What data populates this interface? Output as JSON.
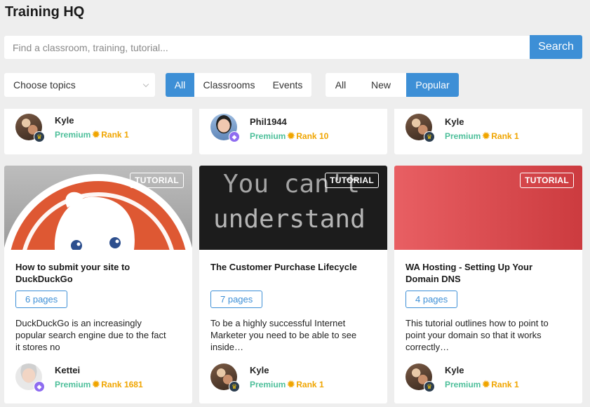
{
  "app": {
    "title": "Training HQ"
  },
  "search": {
    "placeholder": "Find a classroom, training, tutorial...",
    "button_label": "Search"
  },
  "filters": {
    "topics_label": "Choose topics",
    "type_options": [
      {
        "label": "All",
        "active": true
      },
      {
        "label": "Classrooms",
        "active": false
      },
      {
        "label": "Events",
        "active": false
      }
    ],
    "sort_options": [
      {
        "label": "All",
        "active": false
      },
      {
        "label": "New",
        "active": false
      },
      {
        "label": "Popular",
        "active": true
      }
    ]
  },
  "top_cards": [
    {
      "author": "Kyle",
      "membership": "Premium",
      "rank": "Rank 1",
      "badge": "crown-icon"
    },
    {
      "author": "Phil1944",
      "membership": "Premium",
      "rank": "Rank 10",
      "badge": "gem-icon"
    },
    {
      "author": "Kyle",
      "membership": "Premium",
      "rank": "Rank 1",
      "badge": "crown-icon"
    }
  ],
  "cards": [
    {
      "tag": "TUTORIAL",
      "title": "How to submit your site to DuckDuckGo",
      "pages": "6 pages",
      "description": "DuckDuckGo is an increasingly popular search engine due to the fact it stores no",
      "author": "Kettei",
      "membership": "Premium",
      "rank": "Rank 1681",
      "badge": "gem-icon"
    },
    {
      "tag": "TUTORIAL",
      "title": "The Customer Purchase Lifecycle",
      "pages": "7 pages",
      "description": "To be a highly successful Internet Marketer you need to be able to see inside…",
      "author": "Kyle",
      "membership": "Premium",
      "rank": "Rank 1",
      "badge": "crown-icon"
    },
    {
      "tag": "TUTORIAL",
      "title": "WA Hosting - Setting Up Your Domain DNS",
      "pages": "4 pages",
      "description": "This tutorial outlines how to point to point your domain so that it works correctly…",
      "author": "Kyle",
      "membership": "Premium",
      "rank": "Rank 1",
      "badge": "crown-icon"
    }
  ],
  "thumbnails": {
    "chalkboard_text_line1": "You can't",
    "chalkboard_text_line2": "understand"
  },
  "colors": {
    "accent": "#3d8fd6",
    "premium": "#4dbf9a",
    "rank": "#f0a500",
    "background": "#eeeeee"
  }
}
